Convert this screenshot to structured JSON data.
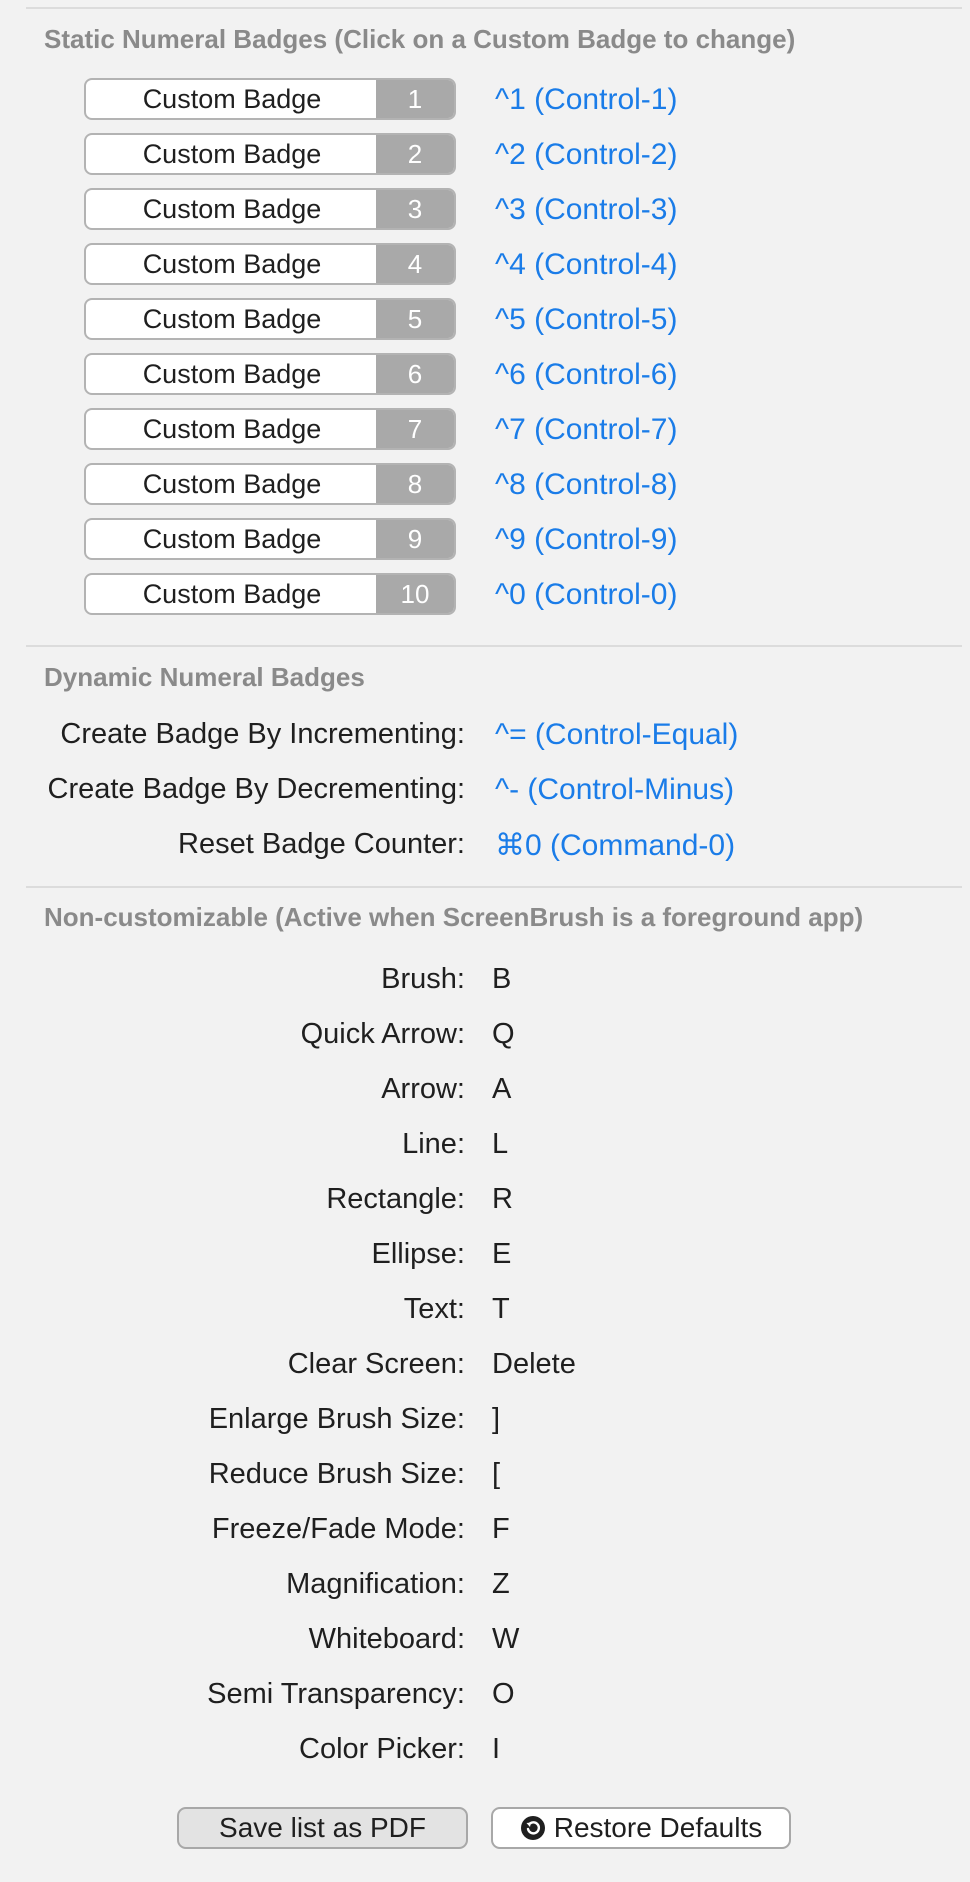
{
  "sections": {
    "static_title": "Static Numeral Badges (Click on a Custom Badge to change)",
    "dynamic_title": "Dynamic Numeral Badges",
    "noncustom_title": "Non-customizable (Active when ScreenBrush is a foreground app)"
  },
  "static_badges": [
    {
      "label": "Custom Badge",
      "number": "1",
      "shortcut": "^1  (Control-1)"
    },
    {
      "label": "Custom Badge",
      "number": "2",
      "shortcut": "^2  (Control-2)"
    },
    {
      "label": "Custom Badge",
      "number": "3",
      "shortcut": "^3  (Control-3)"
    },
    {
      "label": "Custom Badge",
      "number": "4",
      "shortcut": "^4  (Control-4)"
    },
    {
      "label": "Custom Badge",
      "number": "5",
      "shortcut": "^5  (Control-5)"
    },
    {
      "label": "Custom Badge",
      "number": "6",
      "shortcut": "^6  (Control-6)"
    },
    {
      "label": "Custom Badge",
      "number": "7",
      "shortcut": "^7  (Control-7)"
    },
    {
      "label": "Custom Badge",
      "number": "8",
      "shortcut": "^8  (Control-8)"
    },
    {
      "label": "Custom Badge",
      "number": "9",
      "shortcut": "^9  (Control-9)"
    },
    {
      "label": "Custom Badge",
      "number": "10",
      "shortcut": "^0  (Control-0)"
    }
  ],
  "dynamic_badges": [
    {
      "label": "Create Badge By Incrementing:",
      "shortcut": "^=  (Control-Equal)"
    },
    {
      "label": "Create Badge By Decrementing:",
      "shortcut": "^-  (Control-Minus)"
    },
    {
      "label": "Reset Badge Counter:",
      "shortcut": "⌘0  (Command-0)"
    }
  ],
  "noncustom_shortcuts": [
    {
      "label": "Brush:",
      "key": "B"
    },
    {
      "label": "Quick Arrow:",
      "key": "Q"
    },
    {
      "label": "Arrow:",
      "key": "A"
    },
    {
      "label": "Line:",
      "key": "L"
    },
    {
      "label": "Rectangle:",
      "key": "R"
    },
    {
      "label": "Ellipse:",
      "key": "E"
    },
    {
      "label": "Text:",
      "key": "T"
    },
    {
      "label": "Clear Screen:",
      "key": "Delete"
    },
    {
      "label": "Enlarge Brush Size:",
      "key": "]"
    },
    {
      "label": "Reduce Brush Size:",
      "key": "["
    },
    {
      "label": "Freeze/Fade Mode:",
      "key": "F"
    },
    {
      "label": "Magnification:",
      "key": "Z"
    },
    {
      "label": "Whiteboard:",
      "key": "W"
    },
    {
      "label": "Semi Transparency:",
      "key": "O"
    },
    {
      "label": "Color Picker:",
      "key": "I"
    }
  ],
  "buttons": {
    "save_pdf": "Save list as PDF",
    "restore_defaults": "Restore Defaults"
  },
  "icons": {
    "restore": "restore-icon"
  },
  "colors": {
    "link": "#1a7ce8",
    "section_title": "#8a8a8a",
    "badge_number_bg": "#a9a9a9"
  }
}
